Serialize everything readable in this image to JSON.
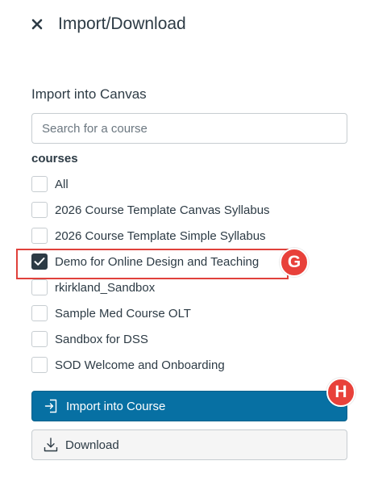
{
  "header": {
    "title": "Import/Download"
  },
  "import": {
    "section_label": "Import into Canvas",
    "search_placeholder": "Search for a course",
    "courses_heading": "courses",
    "courses": [
      {
        "label": "All",
        "checked": false
      },
      {
        "label": "2026 Course Template Canvas Syllabus",
        "checked": false
      },
      {
        "label": "2026 Course Template Simple Syllabus",
        "checked": false
      },
      {
        "label": "Demo for Online Design and Teaching",
        "checked": true
      },
      {
        "label": "rkirkland_Sandbox",
        "checked": false
      },
      {
        "label": "Sample Med Course OLT",
        "checked": false
      },
      {
        "label": "Sandbox for DSS",
        "checked": false
      },
      {
        "label": "SOD Welcome and Onboarding",
        "checked": false
      }
    ]
  },
  "annotations": {
    "g": "G",
    "h": "H"
  },
  "buttons": {
    "import_label": "Import into Course",
    "download_label": "Download"
  },
  "colors": {
    "primary": "#0770a3",
    "annotation": "#e8413a",
    "checked": "#2d3b45"
  }
}
